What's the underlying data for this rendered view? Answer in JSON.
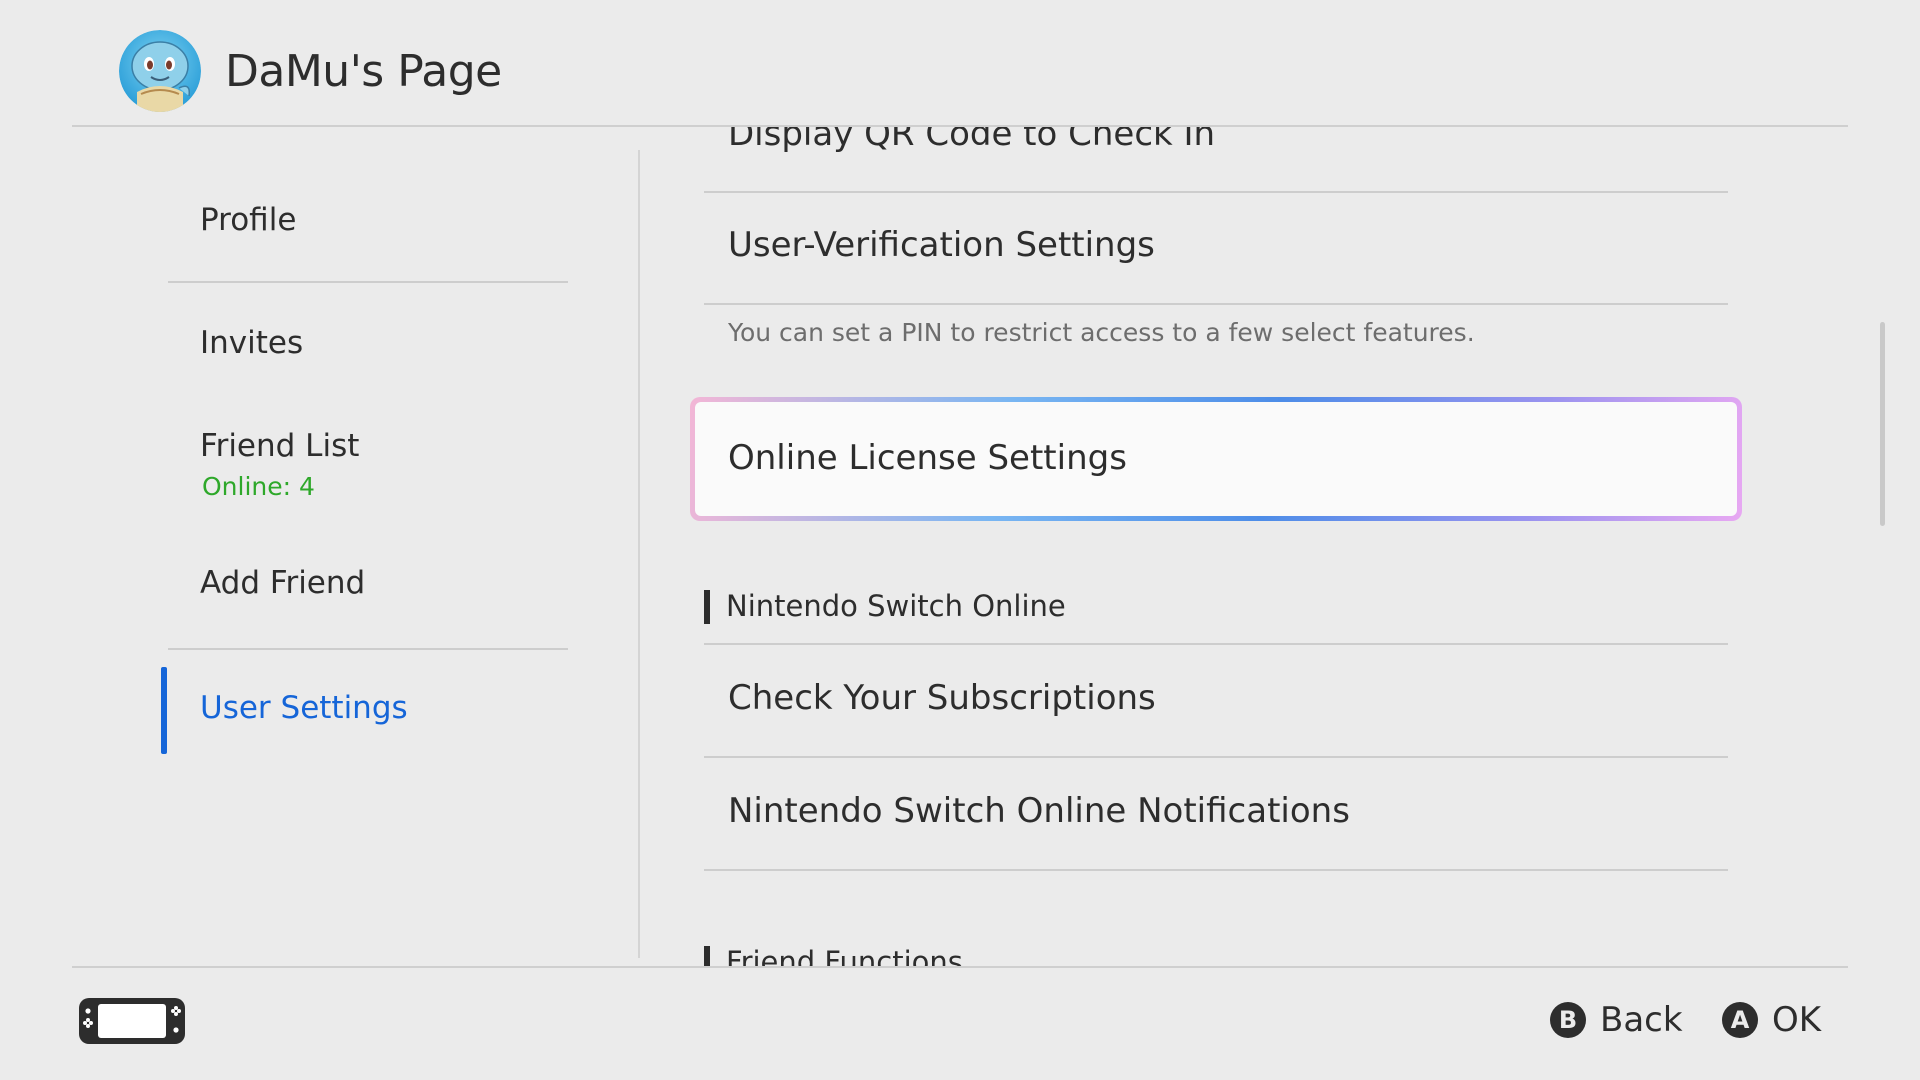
{
  "header": {
    "title": "DaMu's Page",
    "avatar_icon": "squirtle-avatar-icon"
  },
  "sidebar": {
    "items": [
      {
        "label": "Profile"
      },
      {
        "label": "Invites"
      },
      {
        "label": "Friend List",
        "sub": "Online: 4"
      },
      {
        "label": "Add Friend"
      },
      {
        "label": "User Settings",
        "selected": true
      }
    ]
  },
  "content": {
    "items": [
      {
        "label": "Display QR Code to Check In"
      },
      {
        "label": "User-Verification Settings",
        "description": "You can set a PIN to restrict access to a few select features."
      },
      {
        "label": "Online License Settings",
        "focused": true
      }
    ],
    "sections": [
      {
        "title": "Nintendo Switch Online",
        "items": [
          {
            "label": "Check Your Subscriptions"
          },
          {
            "label": "Nintendo Switch Online Notifications"
          }
        ]
      },
      {
        "title": "Friend Functions"
      }
    ]
  },
  "footer": {
    "console_icon": "handheld-console-icon",
    "back": {
      "key": "B",
      "label": "Back"
    },
    "ok": {
      "key": "A",
      "label": "OK"
    }
  },
  "colors": {
    "background": "#ebebeb",
    "accent_blue": "#1565d8",
    "online_green": "#2ea82a",
    "text": "#2d2d2d"
  }
}
